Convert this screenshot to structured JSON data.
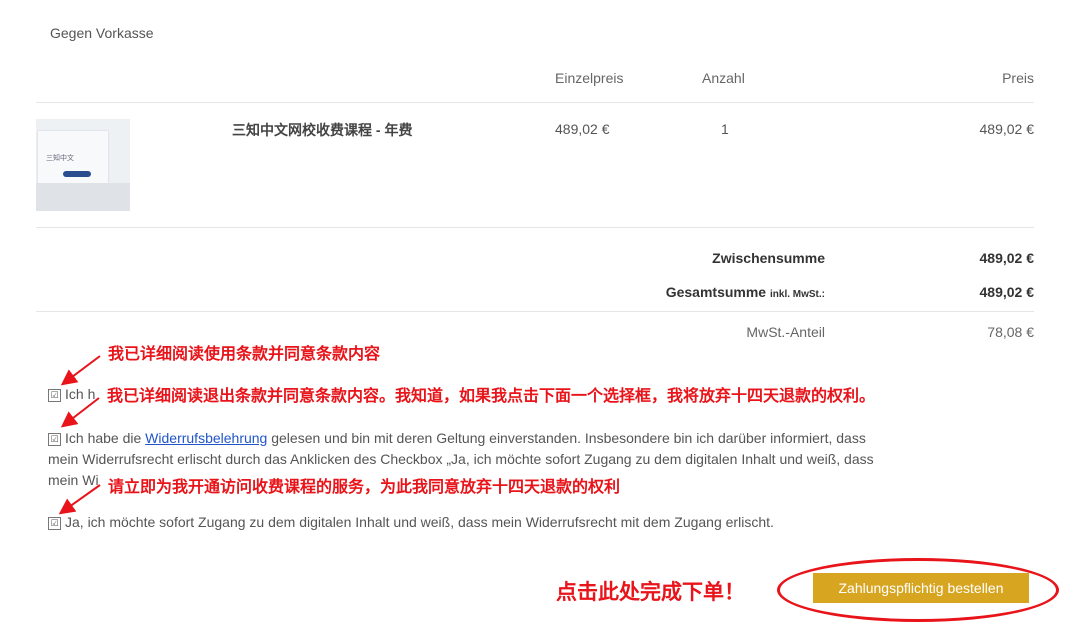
{
  "payment_method": "Gegen Vorkasse",
  "table": {
    "headers": {
      "unit_price": "Einzelpreis",
      "quantity": "Anzahl",
      "price": "Preis"
    },
    "item": {
      "name": "三知中文网校收费课程 - 年费",
      "unit_price": "489,02 €",
      "quantity": "1",
      "price": "489,02 €"
    },
    "thumbnail_text": "三知中文"
  },
  "totals": {
    "subtotal_label": "Zwischensumme",
    "subtotal_value": "489,02 €",
    "total_label": "Gesamtsumme",
    "total_suffix": "inkl. MwSt.:",
    "total_value": "489,02 €",
    "vat_label": "MwSt.-Anteil",
    "vat_value": "78,08 €"
  },
  "checkboxes": {
    "terms_visible_prefix": "Ich h",
    "widerruf_before": "Ich habe die ",
    "widerruf_link": "Widerrufsbelehrung",
    "widerruf_after_line1": " gelesen und bin mit deren Geltung einverstanden. Insbesondere bin ich darüber informiert, dass",
    "widerruf_line2": "mein Widerrufsrecht erlischt durch das Anklicken des Checkbox „Ja, ich möchte sofort Zugang zu dem digitalen Inhalt und weiß, dass",
    "widerruf_line3_prefix": "mein Wi",
    "access_text": "Ja, ich möchte sofort Zugang zu dem digitalen Inhalt und weiß, dass mein Widerrufsrecht mit dem Zugang erlischt.",
    "check_glyph": "☑"
  },
  "annotations": {
    "note1": "我已详细阅读使用条款并同意条款内容",
    "note2": "我已详细阅读退出条款并同意条款内容。我知道，如果我点击下面一个选择框，我将放弃十四天退款的权利。",
    "note3": "请立即为我开通访问收费课程的服务，为此我同意放弃十四天退款的权利",
    "click_hint": "点击此处完成下单！"
  },
  "order_button_label": "Zahlungspflichtig bestellen",
  "colors": {
    "annotation_red": "#e8141a",
    "button_gold": "#d7a520",
    "link_blue": "#2055c9"
  }
}
